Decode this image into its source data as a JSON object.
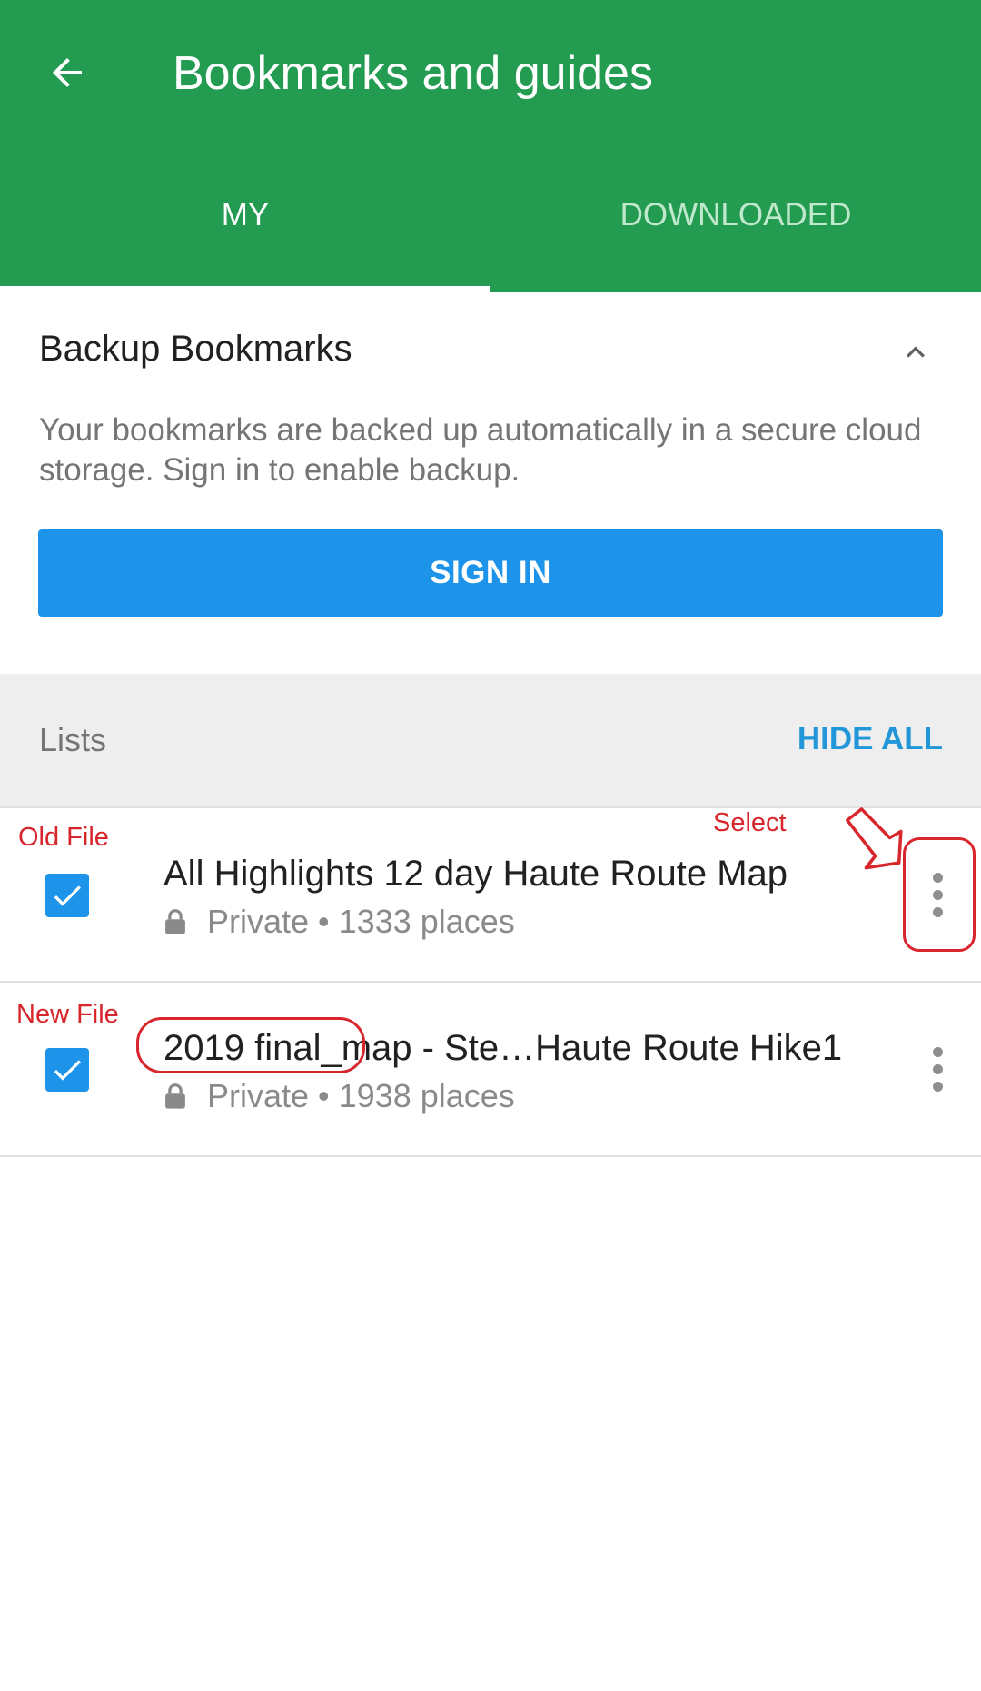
{
  "header": {
    "title": "Bookmarks and guides",
    "back_icon": "arrow-left-icon",
    "bg_color": "#239c52"
  },
  "tabs": [
    {
      "label": "MY",
      "selected": true
    },
    {
      "label": "DOWNLOADED",
      "selected": false
    }
  ],
  "backup": {
    "title": "Backup Bookmarks",
    "description": "Your bookmarks are backed up automatically in a secure cloud storage. Sign in to enable backup.",
    "button_label": "SIGN IN",
    "button_color": "#1e93ea",
    "collapse_icon": "chevron-up-icon"
  },
  "lists": {
    "label": "Lists",
    "hide_all": "HIDE ALL",
    "items": [
      {
        "title": "All Highlights 12 day Haute Route Map",
        "subtitle": "Private • 1333 places",
        "checked": true
      },
      {
        "title": "2019 final_map - Ste…Haute Route Hike1",
        "subtitle": "Private • 1938 places",
        "checked": true
      }
    ]
  },
  "annotations": {
    "old_file": "Old File",
    "new_file": "New File",
    "select": "Select",
    "color": "#d7262c"
  }
}
